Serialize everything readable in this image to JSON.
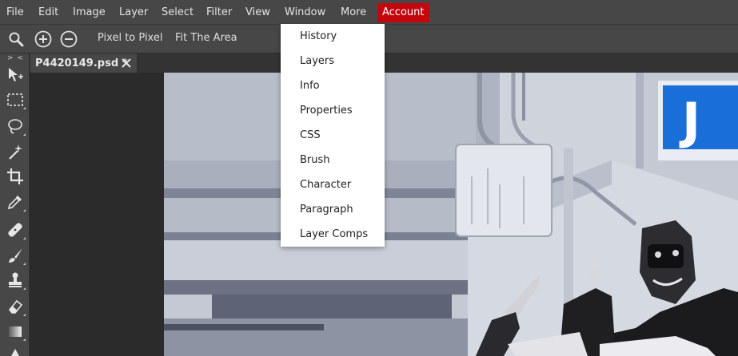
{
  "menubar": {
    "items": [
      "File",
      "Edit",
      "Image",
      "Layer",
      "Select",
      "Filter",
      "View",
      "Window",
      "More",
      "Account"
    ]
  },
  "options": {
    "search_icon": "magnifier-icon",
    "zoom_in_icon": "zoom-in-icon",
    "zoom_out_icon": "zoom-out-icon",
    "pixel_to_pixel": "Pixel to Pixel",
    "fit_area": "Fit The Area"
  },
  "toolbar": {
    "collapse_label": "> <",
    "tools": [
      "move-tool-icon",
      "marquee-tool-icon",
      "lasso-tool-icon",
      "magic-wand-icon",
      "crop-icon",
      "eyedropper-icon",
      "healing-brush-icon",
      "brush-icon",
      "clone-stamp-icon",
      "eraser-icon",
      "gradient-icon",
      "sharpen-icon"
    ]
  },
  "document": {
    "tab_label": "P4420149.psd *",
    "close_icon": "close-icon",
    "sign_text": "J"
  },
  "window_menu": {
    "items": [
      "History",
      "Layers",
      "Info",
      "Properties",
      "CSS",
      "Brush",
      "Character",
      "Paragraph",
      "Layer Comps"
    ]
  },
  "colors": {
    "account_bg": "#c3070d",
    "panel_bg": "#474747",
    "workspace_bg": "#2b2b2b",
    "sign_blue": "#1a6ed8"
  }
}
